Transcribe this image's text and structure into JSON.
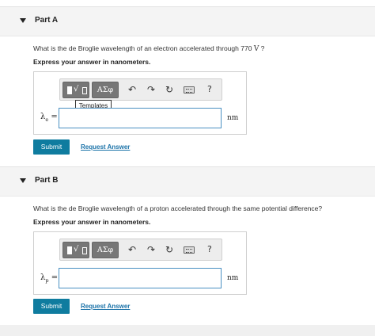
{
  "part_a": {
    "title": "Part A",
    "question_text": "What is the de Broglie wavelength of an electron accelerated through 770",
    "question_unit": "V",
    "question_end": " ?",
    "instruction": "Express your answer in nanometers.",
    "toolbar": {
      "symbols_label": "ΑΣφ",
      "undo_icon": "↶",
      "redo_icon": "↷",
      "reset_icon": "↻",
      "help_label": "?",
      "templates_tooltip": "Templates"
    },
    "lhs_symbol": "λ",
    "lhs_sub": "e",
    "lhs_eq": " =",
    "input_value": "",
    "unit": "nm",
    "submit_label": "Submit",
    "request_label": "Request Answer"
  },
  "part_b": {
    "title": "Part B",
    "question_text": "What is the de Broglie wavelength of a proton accelerated through the same potential difference?",
    "instruction": "Express your answer in nanometers.",
    "toolbar": {
      "symbols_label": "ΑΣφ",
      "undo_icon": "↶",
      "redo_icon": "↷",
      "reset_icon": "↻",
      "help_label": "?"
    },
    "lhs_symbol": "λ",
    "lhs_sub": "p",
    "lhs_eq": " =",
    "input_value": "",
    "unit": "nm",
    "submit_label": "Submit",
    "request_label": "Request Answer"
  }
}
